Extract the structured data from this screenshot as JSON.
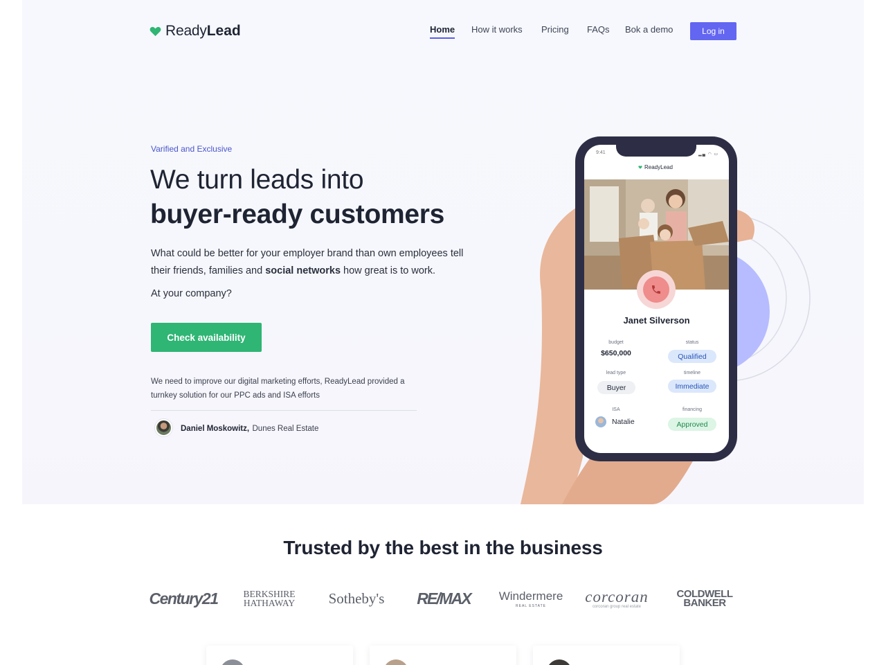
{
  "brand": {
    "name_part1": "Ready",
    "name_part2": "Lead",
    "heart_color": "#2fb574"
  },
  "nav": {
    "items": [
      {
        "label": "Home",
        "active": true
      },
      {
        "label": "How it works",
        "active": false
      },
      {
        "label": "Pricing",
        "active": false
      },
      {
        "label": "FAQs",
        "active": false
      },
      {
        "label": "Bok a demo",
        "active": false
      }
    ],
    "login_label": "Log in"
  },
  "hero": {
    "eyebrow": "Varified and Exclusive",
    "title_line1": "We turn leads into",
    "title_line2": "buyer-ready customers",
    "description_part1": "What could be better for your employer brand than own employees tell their friends, families and ",
    "description_bold": "social networks",
    "description_part2": " how great is to work.",
    "question": "At your company?",
    "cta_label": "Check availability",
    "testimonial_quote": "We need to improve our digital marketing efforts, ReadyLead provided a turnkey solution for our PPC ads and ISA efforts",
    "testimonial_name": "Daniel Moskowitz,",
    "testimonial_company": "Dunes Real Estate"
  },
  "phone": {
    "time": "9:41",
    "app_brand": "ReadyLead",
    "contact_name": "Janet Silverson",
    "fields": {
      "budget_label": "budget",
      "budget_value": "$650,000",
      "status_label": "status",
      "status_value": "Qualified",
      "lead_type_label": "lead type",
      "lead_type_value": "Buyer",
      "timeline_label": "timeline",
      "timeline_value": "Immediate",
      "isa_label": "ISA",
      "isa_value": "Natalie",
      "financing_label": "financing",
      "financing_value": "Approved"
    }
  },
  "trusted": {
    "heading": "Trusted by the best in the business",
    "logos": {
      "century": "Century21",
      "berkshire_1": "BERKSHIRE",
      "berkshire_2": "HATHAWAY",
      "sothebys": "Sotheby's",
      "remax": "RE/MAX",
      "windermere": "Windermere",
      "windermere_sub": "REAL ESTATE",
      "corcoran": "corcoran",
      "corcoran_sub": "corcoran group real estate",
      "coldwell_1": "COLDWELL",
      "coldwell_2": "BANKER"
    }
  },
  "colors": {
    "accent": "#6366f1",
    "cta": "#2fb574",
    "text": "#1f2433"
  }
}
